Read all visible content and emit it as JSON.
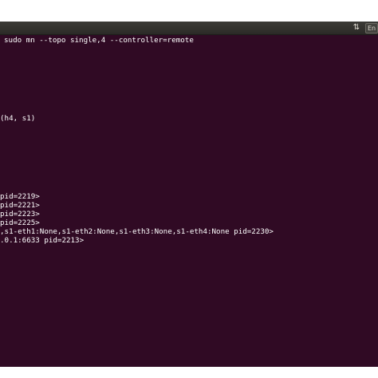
{
  "topbar": {
    "icons": [
      "transfer-arrows-icon",
      "keyboard-language-icon"
    ],
    "language_label": "En",
    "transfer_glyph": "⇅"
  },
  "terminal": {
    "lines": [
      "sudo mn --topo single,4 --controller=remote",
      "(h4, s1)",
      "pid=2219>",
      "pid=2221>",
      "pid=2223>",
      "pid=2225>",
      ",s1-eth1:None,s1-eth2:None,s1-eth3:None,s1-eth4:None pid=2230>",
      ".0.1:6633 pid=2213>"
    ]
  },
  "colors": {
    "terminal_bg": "#300a24",
    "text": "#ffffff",
    "topbar": "#3c3b37"
  }
}
